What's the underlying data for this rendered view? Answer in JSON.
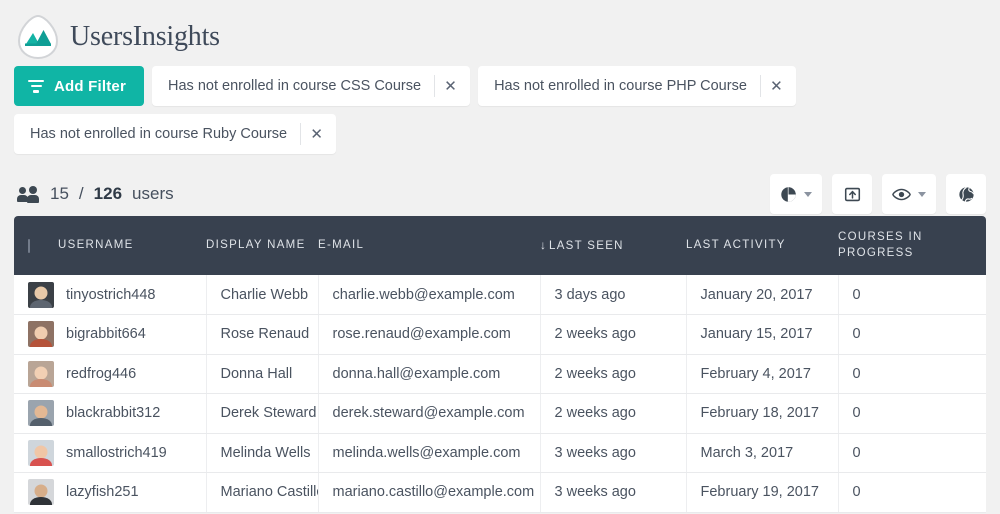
{
  "brand": {
    "name": "UsersInsights",
    "logo_icon": "mountain-logo-icon",
    "accent_color": "#10b5a5",
    "header_bg": "#38414f",
    "page_bg": "#f1f1f1"
  },
  "filters": {
    "add_button_label": "Add Filter",
    "add_button_icon": "filter-funnel-icon",
    "chips": [
      {
        "label": "Has not enrolled in course CSS Course",
        "remove_icon": "close-icon"
      },
      {
        "label": "Has not enrolled in course PHP Course",
        "remove_icon": "close-icon"
      },
      {
        "label": "Has not enrolled in course Ruby Course",
        "remove_icon": "close-icon"
      }
    ]
  },
  "summary": {
    "icon": "users-icon",
    "shown": "15",
    "separator": "/",
    "total": "126",
    "suffix": "users"
  },
  "toolbar": [
    {
      "name": "charts-button",
      "icon": "pie-chart-icon",
      "has_caret": true
    },
    {
      "name": "export-button",
      "icon": "export-box-icon",
      "has_caret": false
    },
    {
      "name": "columns-visibility-button",
      "icon": "eye-icon",
      "has_caret": true
    },
    {
      "name": "map-button",
      "icon": "globe-icon",
      "has_caret": false
    }
  ],
  "table": {
    "select_all_checkbox": "select-all-checkbox",
    "sort_indicator": "↓",
    "sorted_column": "LAST SEEN",
    "columns": [
      {
        "label": "USERNAME"
      },
      {
        "label": "DISPLAY NAME"
      },
      {
        "label": "E-MAIL"
      },
      {
        "label": "LAST SEEN"
      },
      {
        "label": "LAST ACTIVITY"
      },
      {
        "label": "COURSES IN",
        "label2": "PROGRESS"
      }
    ],
    "rows": [
      {
        "username": "tinyostrich448",
        "display_name": "Charlie Webb",
        "email": "charlie.webb@example.com",
        "last_seen": "3 days ago",
        "last_activity": "January 20, 2017",
        "courses_in_progress": "0",
        "avatar_face": "#e8c9a8",
        "avatar_bg": "#3b4046",
        "avatar_shoulder": "#5d6570"
      },
      {
        "username": "bigrabbit664",
        "display_name": "Rose Renaud",
        "email": "rose.renaud@example.com",
        "last_seen": "2 weeks ago",
        "last_activity": "January 15, 2017",
        "courses_in_progress": "0",
        "avatar_face": "#f0cdb0",
        "avatar_bg": "#8e7264",
        "avatar_shoulder": "#b5533a"
      },
      {
        "username": "redfrog446",
        "display_name": "Donna Hall",
        "email": "donna.hall@example.com",
        "last_seen": "2 weeks ago",
        "last_activity": "February 4, 2017",
        "courses_in_progress": "0",
        "avatar_face": "#f2d0b4",
        "avatar_bg": "#b9a596",
        "avatar_shoulder": "#c98b72"
      },
      {
        "username": "blackrabbit312",
        "display_name": "Derek Steward",
        "email": "derek.steward@example.com",
        "last_seen": "2 weeks ago",
        "last_activity": "February 18, 2017",
        "courses_in_progress": "0",
        "avatar_face": "#e3b894",
        "avatar_bg": "#9aa4ae",
        "avatar_shoulder": "#55606c"
      },
      {
        "username": "smallostrich419",
        "display_name": "Melinda Wells",
        "email": "melinda.wells@example.com",
        "last_seen": "3 weeks ago",
        "last_activity": "March 3, 2017",
        "courses_in_progress": "0",
        "avatar_face": "#f0c6a6",
        "avatar_bg": "#cfd6dc",
        "avatar_shoulder": "#d8524f"
      },
      {
        "username": "lazyfish251",
        "display_name": "Mariano Castillo",
        "email": "mariano.castillo@example.com",
        "last_seen": "3 weeks ago",
        "last_activity": "February 19, 2017",
        "courses_in_progress": "0",
        "avatar_face": "#d7ae8a",
        "avatar_bg": "#d5d7da",
        "avatar_shoulder": "#2f3338"
      }
    ]
  }
}
